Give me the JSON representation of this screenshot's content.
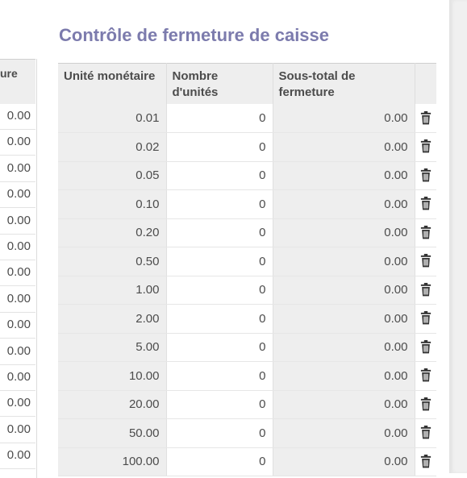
{
  "title": "Contrôle de fermeture de caisse",
  "left_panel": {
    "header_fragment": "ure",
    "values": [
      "0.00",
      "0.00",
      "0.00",
      "0.00",
      "0.00",
      "0.00",
      "0.00",
      "0.00",
      "0.00",
      "0.00",
      "0.00",
      "0.00",
      "0.00",
      "0.00"
    ]
  },
  "table": {
    "headers": {
      "unit": "Unité monétaire",
      "count_line1": "Nombre",
      "count_line2": "d'unités",
      "subtotal_line1": "Sous-total de",
      "subtotal_line2": "fermeture"
    },
    "rows": [
      {
        "unit": "0.01",
        "count": "0",
        "subtotal": "0.00"
      },
      {
        "unit": "0.02",
        "count": "0",
        "subtotal": "0.00"
      },
      {
        "unit": "0.05",
        "count": "0",
        "subtotal": "0.00"
      },
      {
        "unit": "0.10",
        "count": "0",
        "subtotal": "0.00"
      },
      {
        "unit": "0.20",
        "count": "0",
        "subtotal": "0.00"
      },
      {
        "unit": "0.50",
        "count": "0",
        "subtotal": "0.00"
      },
      {
        "unit": "1.00",
        "count": "0",
        "subtotal": "0.00"
      },
      {
        "unit": "2.00",
        "count": "0",
        "subtotal": "0.00"
      },
      {
        "unit": "5.00",
        "count": "0",
        "subtotal": "0.00"
      },
      {
        "unit": "10.00",
        "count": "0",
        "subtotal": "0.00"
      },
      {
        "unit": "20.00",
        "count": "0",
        "subtotal": "0.00"
      },
      {
        "unit": "50.00",
        "count": "0",
        "subtotal": "0.00"
      },
      {
        "unit": "100.00",
        "count": "0",
        "subtotal": "0.00"
      }
    ],
    "delete_icon": "trash-icon"
  },
  "colors": {
    "title": "#7c7bad",
    "header_bg": "#eeeeee",
    "text": "#4c4c4c"
  }
}
